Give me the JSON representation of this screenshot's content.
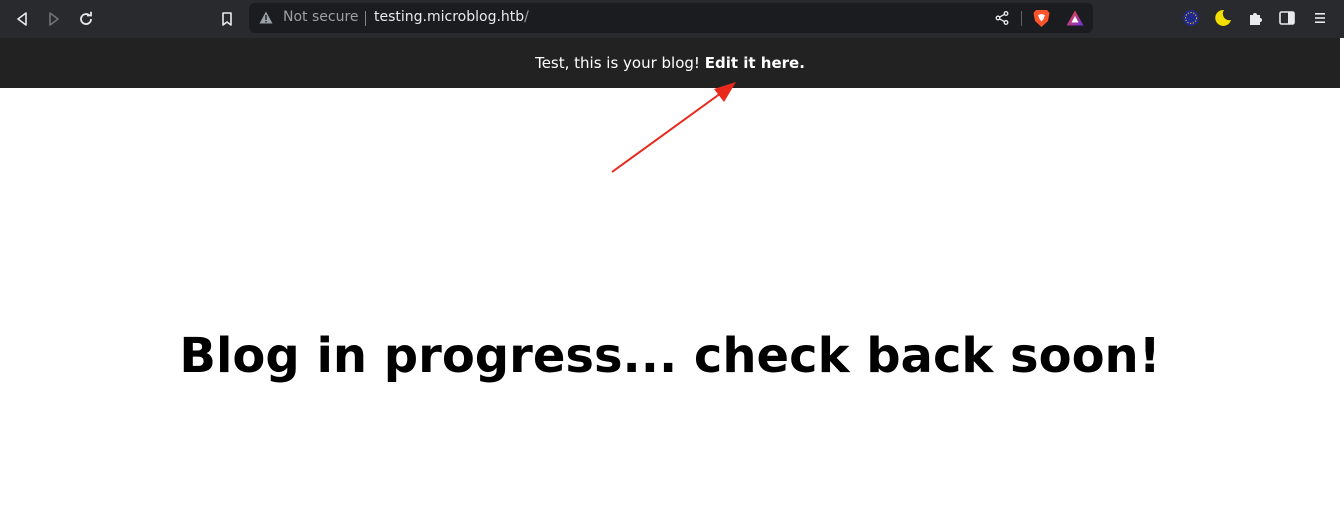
{
  "browser": {
    "url_security_label": "Not secure",
    "url_host": "testing.microblog.htb",
    "url_path": "/"
  },
  "page": {
    "banner_prefix": "Test, this is your blog! ",
    "banner_link": "Edit it here.",
    "headline": "Blog in progress... check back soon!"
  },
  "colors": {
    "toolbar_bg": "#292a2d",
    "urlbar_bg": "#1b1c1f",
    "banner_bg": "#222222",
    "annotation_arrow": "#e8291c"
  },
  "icons": [
    "back-icon",
    "forward-icon",
    "reload-icon",
    "bookmark-icon",
    "warning-icon",
    "share-icon",
    "brave-shields-icon",
    "brave-rewards-icon",
    "extension-globe-icon",
    "dark-mode-moon-icon",
    "extensions-puzzle-icon",
    "sidebar-icon",
    "menu-icon"
  ]
}
